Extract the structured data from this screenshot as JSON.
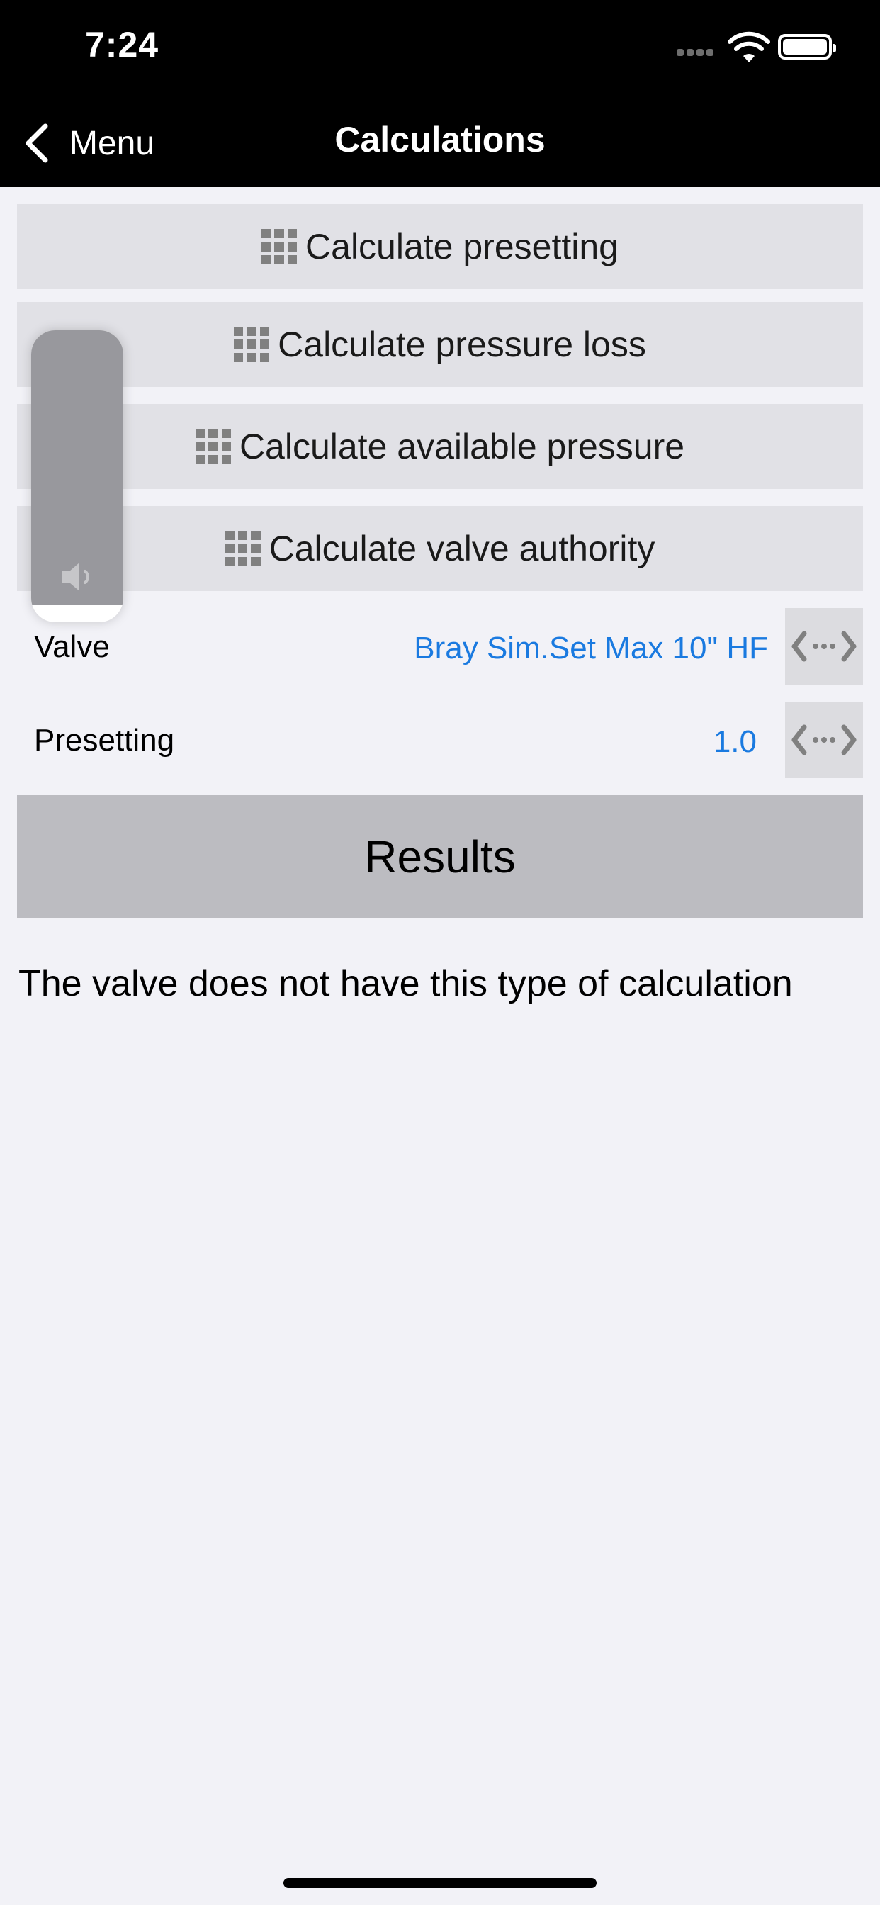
{
  "status_bar": {
    "time": "7:24",
    "signal_icon": "signal-dots-icon",
    "wifi_icon": "wifi-icon",
    "battery_icon": "battery-icon"
  },
  "nav": {
    "back_label": "Menu",
    "title": "Calculations",
    "back_icon": "chevron-left-icon"
  },
  "calc_buttons": [
    {
      "label": "Calculate presetting",
      "icon": "grid-icon"
    },
    {
      "label": "Calculate pressure loss",
      "icon": "grid-icon"
    },
    {
      "label": "Calculate available pressure",
      "icon": "grid-icon"
    },
    {
      "label": "Calculate valve authority",
      "icon": "grid-icon"
    }
  ],
  "fields": {
    "valve": {
      "label": "Valve",
      "value": "Bray Sim.Set Max 10\" HF"
    },
    "presetting": {
      "label": "Presetting",
      "value": "1.0"
    }
  },
  "results": {
    "title": "Results",
    "message": "The valve does not have this type of calculation"
  },
  "volume_hud": {
    "level": 0.94,
    "icon": "speaker-icon"
  },
  "colors": {
    "link": "#1a7ae0",
    "button_bg": "#e1e1e6",
    "results_bg": "#bcbcc1",
    "background": "#f2f2f7"
  }
}
